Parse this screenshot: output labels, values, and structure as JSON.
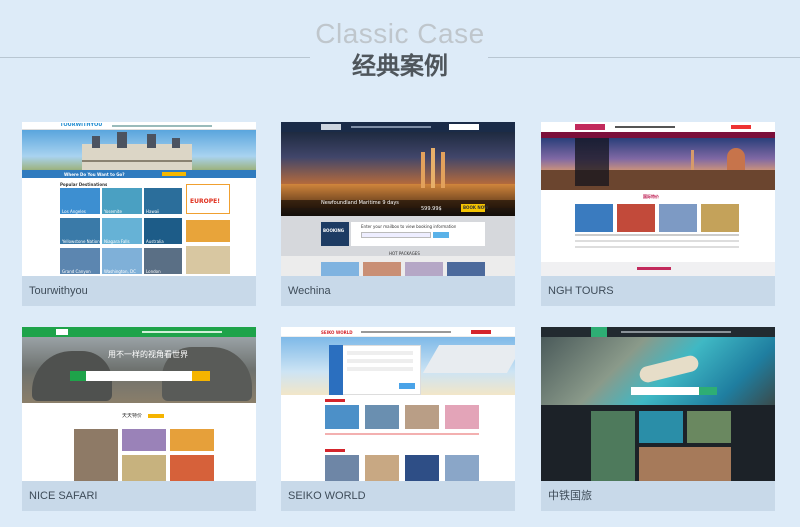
{
  "section": {
    "title_en": "Classic Case",
    "title_zh": "经典案例"
  },
  "cases": [
    {
      "name": "Tourwithyou",
      "logo": "TOURWITHYOU",
      "search_title": "Where Do You Want to Go?",
      "section_title": "Popular Destinations",
      "promo": "EUROPE!",
      "tiles": [
        "Los Angeles",
        "Yosemite",
        "Hawaii",
        "Yellowstone National ...",
        "Niagara Falls",
        "Australia",
        "Grand Canyon",
        "Washington, DC",
        "London"
      ]
    },
    {
      "name": "Wechina",
      "banner_title": "Newfoundland Maritime 9 days",
      "price": "599.99$",
      "book_button": "BOOK NOW",
      "booking_label": "BOOKING",
      "mailbox_text": "Enter your mailbox to view booking information",
      "packages_title": "HOT PACKAGES"
    },
    {
      "name": "NGH TOURS",
      "section_title": "国际特价"
    },
    {
      "name": "NICE SAFARI",
      "banner_text": "用不一样的视角看世界",
      "section_title": "天天特价"
    },
    {
      "name": "SEIKO WORLD",
      "logo": "SEIKO WORLD"
    },
    {
      "name": "中铁国旅"
    }
  ],
  "colors": {
    "page_bg": "#ddebf8",
    "caption_bg": "#c8d9e9",
    "caption_text": "#3e4c59",
    "title_en": "#bfc6cc",
    "title_zh": "#4f565c"
  }
}
